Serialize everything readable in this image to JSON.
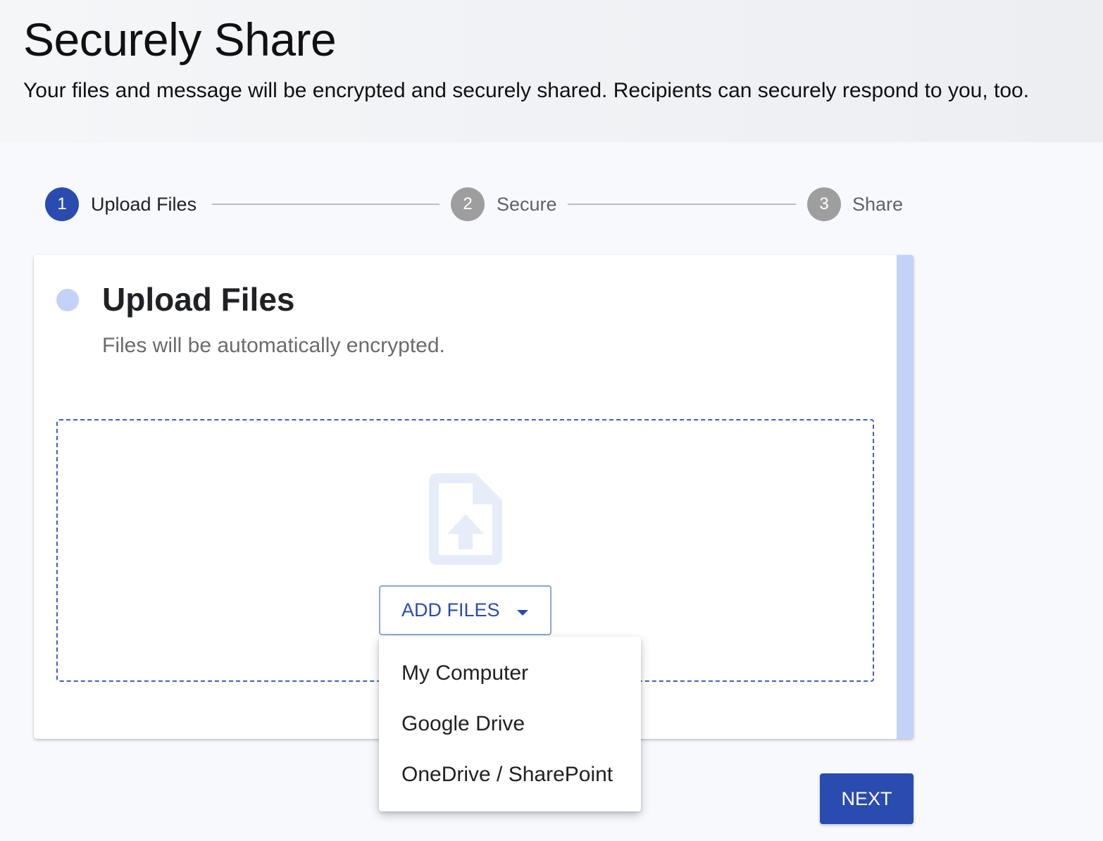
{
  "header": {
    "title": "Securely Share",
    "subtitle": "Your files and message will be encrypted and securely shared. Recipients can securely respond to you, too."
  },
  "stepper": {
    "steps": [
      {
        "number": "1",
        "label": "Upload Files",
        "state": "active"
      },
      {
        "number": "2",
        "label": "Secure",
        "state": "inactive"
      },
      {
        "number": "3",
        "label": "Share",
        "state": "inactive"
      }
    ]
  },
  "card": {
    "title": "Upload Files",
    "description": "Files will be automatically encrypted.",
    "upload_icon": "file-upload-icon",
    "add_files_label": "ADD FILES",
    "add_files_caret_icon": "caret-down-icon"
  },
  "menu": {
    "items": [
      {
        "label": "My Computer"
      },
      {
        "label": "Google Drive"
      },
      {
        "label": "OneDrive / SharePoint"
      }
    ]
  },
  "footer": {
    "next_label": "NEXT"
  },
  "colors": {
    "primary": "#2a4bb0",
    "accent_light": "#c2d3f7",
    "inactive_step": "#9e9e9e"
  }
}
